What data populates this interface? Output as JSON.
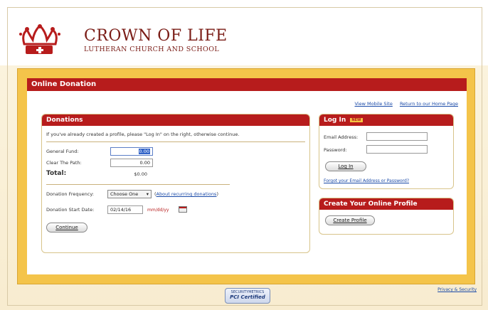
{
  "header": {
    "title": "CROWN OF LIFE",
    "subtitle": "LUTHERAN CHURCH AND SCHOOL"
  },
  "main": {
    "heading": "Online Donation",
    "links": {
      "mobile": "View Mobile Site",
      "home": "Return to our Home Page"
    }
  },
  "donations": {
    "heading": "Donations",
    "intro": "If you've already created a profile, please \"Log In\" on the right, otherwise continue.",
    "funds": [
      {
        "label": "General Fund:",
        "value": "0.00"
      },
      {
        "label": "Clear The Path:",
        "value": "0.00"
      }
    ],
    "total_label": "Total:",
    "total_value": "$0.00",
    "frequency_label": "Donation Frequency:",
    "frequency_value": "Choose One",
    "frequency_link": "About recurring donations",
    "start_label": "Donation Start Date:",
    "start_value": "02/14/16",
    "start_hint": "mm/dd/yy",
    "continue_label": "Continue"
  },
  "login": {
    "heading": "Log In",
    "new_badge": "NEW",
    "email_label": "Email Address:",
    "password_label": "Password:",
    "button_label": "Log In",
    "forgot_link": "Forgot your Email Address or Password?"
  },
  "profile": {
    "heading": "Create Your Online Profile",
    "button_label": "Create Profile"
  },
  "footer": {
    "privacy": "Privacy & Security",
    "badge_top": "SECURITYMETRICS",
    "badge_bottom": "PCI Certified"
  }
}
